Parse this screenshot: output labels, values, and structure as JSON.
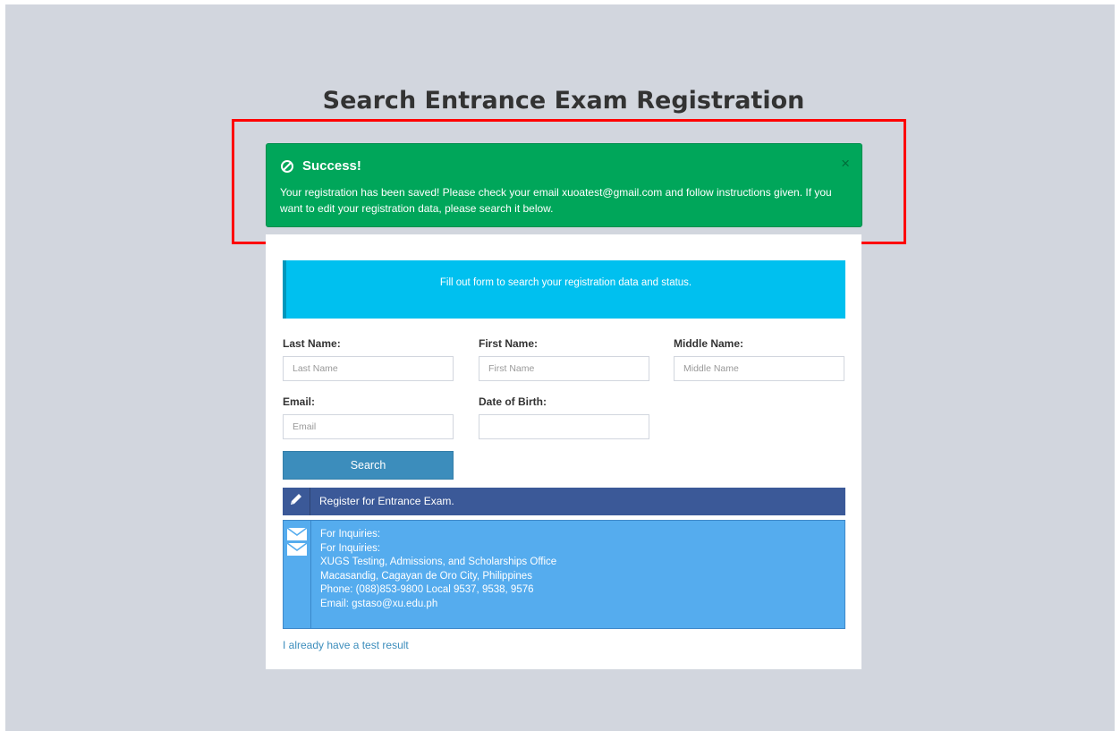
{
  "page": {
    "title": "Search Entrance Exam Registration"
  },
  "alert": {
    "heading": "Success!",
    "message": "Your registration has been saved! Please check your email xuoatest@gmail.com and follow instructions given. If you want to edit your registration data, please search it below.",
    "close": "×",
    "color": "#00a65a"
  },
  "info_banner": {
    "text": "Fill out form to search your registration data and status."
  },
  "form": {
    "last_name": {
      "label": "Last Name:",
      "placeholder": "Last Name",
      "value": ""
    },
    "first_name": {
      "label": "First Name:",
      "placeholder": "First Name",
      "value": ""
    },
    "middle_name": {
      "label": "Middle Name:",
      "placeholder": "Middle Name",
      "value": ""
    },
    "email": {
      "label": "Email:",
      "placeholder": "Email",
      "value": ""
    },
    "dob": {
      "label": "Date of Birth:",
      "placeholder": "",
      "value": ""
    },
    "search_label": "Search"
  },
  "register": {
    "label": "Register for Entrance Exam.",
    "icon": "pencil-icon"
  },
  "inquiry": {
    "icon": "envelope-icon",
    "lines": [
      "For Inquiries:",
      "For Inquiries:",
      "XUGS Testing, Admissions, and Scholarships Office",
      "Macasandig, Cagayan de Oro City, Philippines",
      "Phone: (088)853-9800 Local 9537, 9538, 9576",
      "Email: gstaso@xu.edu.ph"
    ]
  },
  "test_result_link": "I already have a test result"
}
